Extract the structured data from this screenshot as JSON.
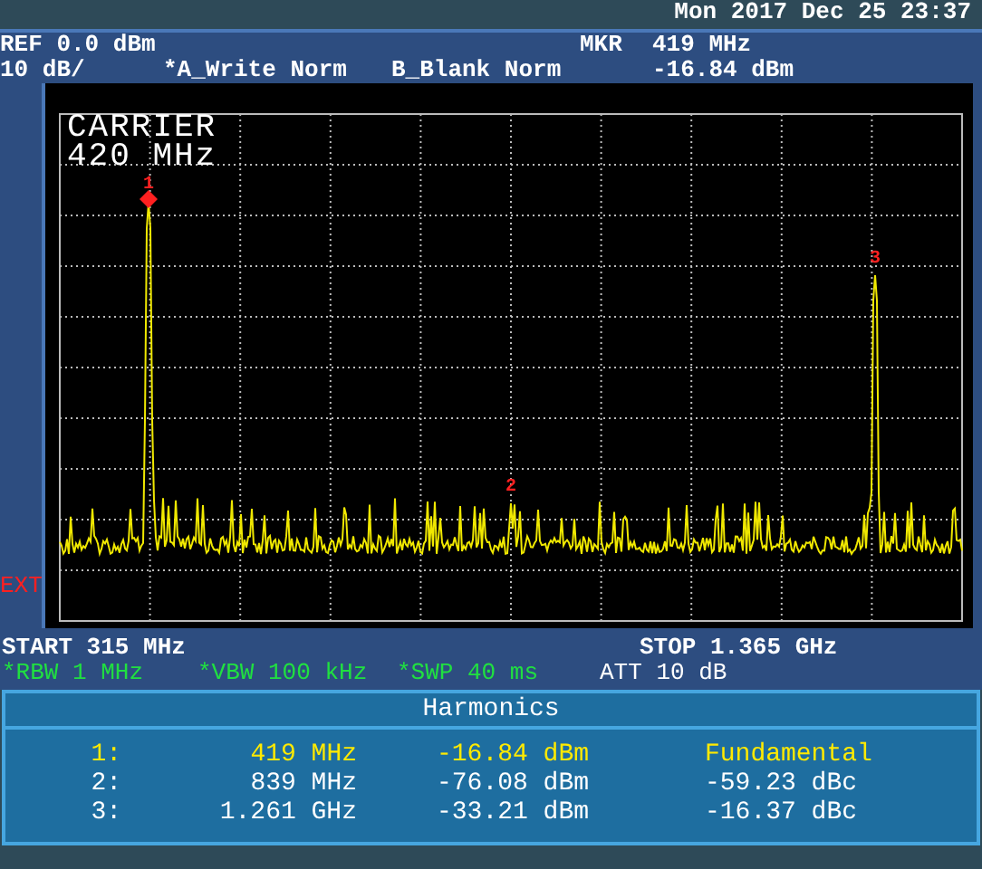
{
  "clock": "Mon 2017 Dec 25 23:37",
  "header": {
    "ref": "REF 0.0 dBm",
    "scale": "10 dB/",
    "trace_a": "*A_Write Norm",
    "trace_b": "B_Blank Norm",
    "marker_label": "MKR",
    "marker_freq": "419 MHz",
    "marker_level": "-16.84 dBm"
  },
  "side_flag": "EXT",
  "plot": {
    "title_line_1": "CARRIER",
    "title_line_2": "420 MHz",
    "markers": [
      {
        "label": "1",
        "active": true
      },
      {
        "label": "2",
        "active": false
      },
      {
        "label": "3",
        "active": false
      }
    ]
  },
  "start": "START 315 MHz",
  "stop": "STOP 1.365 GHz",
  "settings": [
    {
      "text": "*RBW 1 MHz",
      "modified": true
    },
    {
      "text": "*VBW 100 kHz",
      "modified": true
    },
    {
      "text": "*SWP 40 ms",
      "modified": true
    },
    {
      "text": "ATT 10 dB",
      "modified": false
    }
  ],
  "harmonics": {
    "title": "Harmonics",
    "rows": [
      {
        "index": "1:",
        "frequency": "419 MHz",
        "level": "-16.84 dBm",
        "relative": "Fundamental",
        "selected": true
      },
      {
        "index": "2:",
        "frequency": "839 MHz",
        "level": "-76.08 dBm",
        "relative": "-59.23 dBc",
        "selected": false
      },
      {
        "index": "3:",
        "frequency": "1.261 GHz",
        "level": "-33.21 dBm",
        "relative": "-16.37 dBc",
        "selected": false
      }
    ]
  }
}
